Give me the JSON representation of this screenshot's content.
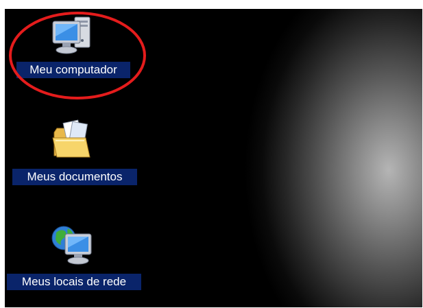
{
  "desktop": {
    "icons": [
      {
        "label": "Meu computador",
        "icon": "my-computer-icon",
        "selected": true
      },
      {
        "label": "Meus documentos",
        "icon": "my-documents-icon",
        "selected": true
      },
      {
        "label": "Meus locais de rede",
        "icon": "network-places-icon",
        "selected": true
      }
    ],
    "colors": {
      "selection_background": "#0a246a",
      "label_text": "#ffffff",
      "desktop_background": "#000000",
      "annotation": "#e41c1c"
    }
  }
}
